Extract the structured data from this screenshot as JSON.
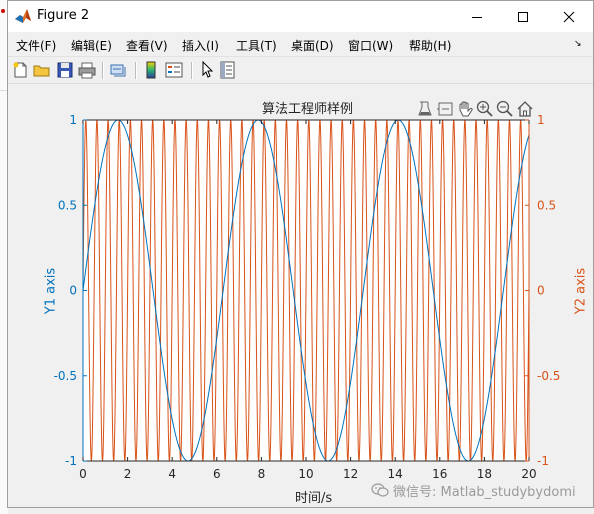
{
  "window": {
    "title": "Figure 2"
  },
  "menubar": {
    "items": [
      {
        "label": "文件(F)"
      },
      {
        "label": "编辑(E)"
      },
      {
        "label": "查看(V)"
      },
      {
        "label": "插入(I)"
      },
      {
        "label": "工具(T)"
      },
      {
        "label": "桌面(D)"
      },
      {
        "label": "窗口(W)"
      },
      {
        "label": "帮助(H)"
      }
    ],
    "overflow_icon": "chevron-right-icon"
  },
  "toolbar": {
    "icons": [
      "new-figure-icon",
      "open-file-icon",
      "save-icon",
      "print-icon",
      "link-icon",
      "colorbar-icon",
      "legend-icon",
      "pointer-icon",
      "property-inspector-icon"
    ]
  },
  "axes_toolbar": {
    "icons": [
      "export-icon",
      "data-tips-icon",
      "pan-icon",
      "zoom-in-icon",
      "zoom-out-icon",
      "home-icon"
    ]
  },
  "watermark": {
    "text": "微信号: Matlab_studybydomi"
  },
  "colors": {
    "y1": "#0072bd",
    "y2": "#d95319",
    "axis_text": "#262626"
  },
  "chart_data": {
    "type": "line",
    "title": "算法工程师样例",
    "xlabel": "时间/s",
    "ylabel_left": "Y1 axis",
    "ylabel_right": "Y2 axis",
    "xlim": [
      0,
      20
    ],
    "ylim_left": [
      -1,
      1
    ],
    "ylim_right": [
      -1,
      1
    ],
    "xticks": [
      "0",
      "2",
      "4",
      "6",
      "8",
      "10",
      "12",
      "14",
      "16",
      "18",
      "20"
    ],
    "yticks_left": [
      "-1",
      "-0.5",
      "0",
      "0.5",
      "1"
    ],
    "yticks_right": [
      "-1",
      "-0.5",
      "0",
      "0.5",
      "1"
    ],
    "grid": false,
    "series": [
      {
        "axis": "left",
        "function": "sin(x)",
        "x": [
          0,
          0.5,
          1,
          1.5,
          2,
          2.5,
          3,
          3.5,
          4,
          4.5,
          5,
          5.5,
          6,
          6.5,
          7,
          7.5,
          8,
          8.5,
          9,
          9.5,
          10,
          10.5,
          11,
          11.5,
          12,
          12.5,
          13,
          13.5,
          14,
          14.5,
          15,
          15.5,
          16,
          16.5,
          17,
          17.5,
          18,
          18.5,
          19,
          19.5,
          20
        ],
        "values": [
          0,
          0.479,
          0.841,
          0.997,
          0.909,
          0.598,
          0.141,
          -0.351,
          -0.757,
          -0.978,
          -0.959,
          -0.706,
          -0.279,
          0.215,
          0.657,
          0.938,
          0.989,
          0.798,
          0.412,
          -0.075,
          -0.544,
          -0.88,
          -1.0,
          -0.875,
          -0.537,
          -0.066,
          0.42,
          0.803,
          0.991,
          0.935,
          0.65,
          0.206,
          -0.288,
          -0.712,
          -0.961,
          -0.976,
          -0.751,
          -0.342,
          0.15,
          0.605,
          0.913
        ]
      },
      {
        "axis": "right",
        "function": "sin(4*pi*x)",
        "cycles_over_range": 40
      }
    ]
  }
}
